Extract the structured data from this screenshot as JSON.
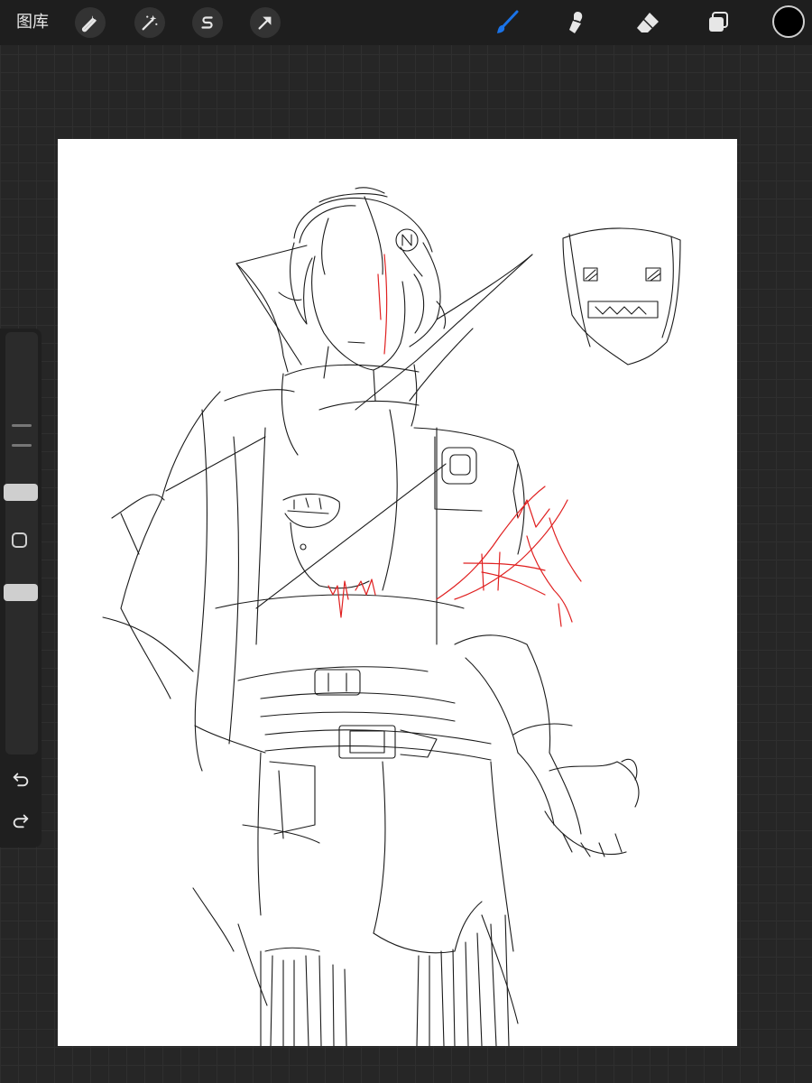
{
  "toolbar": {
    "gallery_label": "图库",
    "left_tools": [
      {
        "name": "actions",
        "icon": "wrench-icon"
      },
      {
        "name": "adjustments",
        "icon": "magic-wand-icon"
      },
      {
        "name": "selection",
        "icon": "selection-s-icon"
      },
      {
        "name": "transform",
        "icon": "arrow-cursor-icon"
      }
    ],
    "right_tools": [
      {
        "name": "brush",
        "icon": "brush-icon",
        "active": true
      },
      {
        "name": "smudge",
        "icon": "smudge-icon"
      },
      {
        "name": "eraser",
        "icon": "eraser-icon"
      },
      {
        "name": "layers",
        "icon": "layers-icon"
      }
    ],
    "active_color": "#000000",
    "accent_color": "#1a73e8"
  },
  "sidebar": {
    "controls": [
      "brush-size-slider",
      "modify-button",
      "opacity-slider",
      "undo-button",
      "redo-button"
    ]
  },
  "canvas": {
    "background": "#ffffff",
    "sketch_colors": [
      "#000000",
      "#e02020"
    ]
  }
}
